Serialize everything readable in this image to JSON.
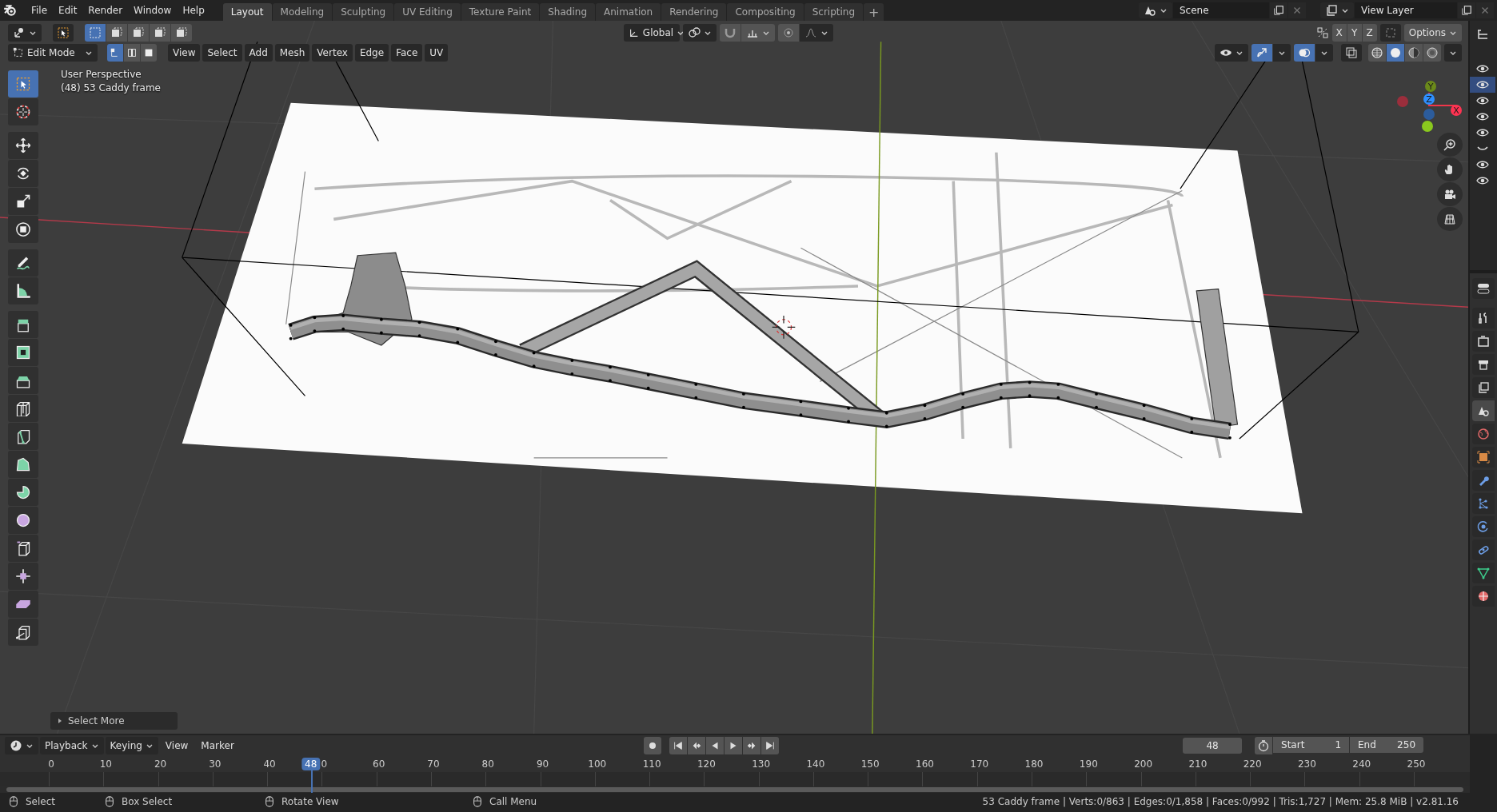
{
  "top_bar": {
    "menus": [
      "File",
      "Edit",
      "Render",
      "Window",
      "Help"
    ],
    "workspaces": [
      {
        "label": "Layout",
        "selected": true
      },
      {
        "label": "Modeling",
        "selected": false
      },
      {
        "label": "Sculpting",
        "selected": false
      },
      {
        "label": "UV Editing",
        "selected": false
      },
      {
        "label": "Texture Paint",
        "selected": false
      },
      {
        "label": "Shading",
        "selected": false
      },
      {
        "label": "Animation",
        "selected": false
      },
      {
        "label": "Rendering",
        "selected": false
      },
      {
        "label": "Compositing",
        "selected": false
      },
      {
        "label": "Scripting",
        "selected": false
      }
    ],
    "add_workspace": "+",
    "scene": "Scene",
    "view_layer": "View Layer"
  },
  "viewport": {
    "header": {
      "mode": "Edit Mode",
      "select_modes": [
        {
          "selected": true
        },
        {
          "selected": false
        },
        {
          "selected": false
        }
      ],
      "menus": [
        "View",
        "Select",
        "Add",
        "Mesh",
        "Vertex",
        "Edge",
        "Face",
        "UV"
      ],
      "transform_orientation": "Global",
      "mirror_axes": [
        {
          "label": "X",
          "on": false
        },
        {
          "label": "Y",
          "on": false
        },
        {
          "label": "Z",
          "on": false
        }
      ],
      "options": "Options",
      "gizmos_on": true,
      "overlays_on": true,
      "xray_on": false,
      "shading": [
        {
          "kind": "wireframe",
          "selected": false
        },
        {
          "kind": "solid",
          "selected": true
        },
        {
          "kind": "material",
          "selected": false
        },
        {
          "kind": "rendered",
          "selected": false
        }
      ]
    },
    "info": [
      "User Perspective",
      "(48) 53 Caddy frame"
    ],
    "tool_groups": [
      [
        {
          "kind": "select-box",
          "selected": true
        },
        {
          "kind": "cursor",
          "selected": false
        }
      ],
      [
        {
          "kind": "move",
          "selected": false
        },
        {
          "kind": "rotate",
          "selected": false
        },
        {
          "kind": "scale",
          "selected": false
        },
        {
          "kind": "transform",
          "selected": false
        }
      ],
      [
        {
          "kind": "annotate",
          "selected": false
        },
        {
          "kind": "measure",
          "selected": false
        }
      ],
      [
        {
          "kind": "extrude",
          "selected": false
        },
        {
          "kind": "inset",
          "selected": false
        },
        {
          "kind": "bevel",
          "selected": false
        },
        {
          "kind": "loop-cut",
          "selected": false
        },
        {
          "kind": "knife",
          "selected": false
        },
        {
          "kind": "poly-build",
          "selected": false
        },
        {
          "kind": "spin",
          "selected": false
        },
        {
          "kind": "smooth",
          "selected": false
        },
        {
          "kind": "edge-slide",
          "selected": false
        },
        {
          "kind": "shrink",
          "selected": false
        },
        {
          "kind": "shear",
          "selected": false
        },
        {
          "kind": "rip",
          "selected": false
        }
      ]
    ],
    "axes": {
      "x": "X",
      "y": "Y",
      "z": "Z"
    },
    "last_operator": "Select More"
  },
  "outliner": {
    "rows": [
      {
        "visible": true,
        "selected": false
      },
      {
        "visible": true,
        "selected": true
      },
      {
        "visible": true,
        "selected": false
      },
      {
        "visible": true,
        "selected": false
      },
      {
        "visible": true,
        "selected": false
      },
      {
        "visible": false,
        "selected": false
      },
      {
        "visible": true,
        "selected": false
      },
      {
        "visible": true,
        "selected": false
      }
    ]
  },
  "properties_tabs": [
    {
      "kind": "tool",
      "selected": false
    },
    {
      "kind": "render",
      "selected": false
    },
    {
      "kind": "output",
      "selected": false
    },
    {
      "kind": "view-layer",
      "selected": false
    },
    {
      "kind": "scene",
      "selected": true
    },
    {
      "kind": "world",
      "selected": false
    },
    {
      "kind": "object",
      "selected": false
    },
    {
      "kind": "modifiers",
      "selected": false
    },
    {
      "kind": "particles",
      "selected": false
    },
    {
      "kind": "physics",
      "selected": false
    },
    {
      "kind": "constraints",
      "selected": false
    },
    {
      "kind": "data",
      "selected": false
    },
    {
      "kind": "material",
      "selected": false
    }
  ],
  "timeline": {
    "menus": [
      "Playback",
      "Keying",
      "View",
      "Marker"
    ],
    "current_frame": "48",
    "start_label": "Start",
    "start": "1",
    "end_label": "End",
    "end": "250",
    "ruler": [
      "0",
      "10",
      "20",
      "30",
      "40",
      "0",
      "60",
      "70",
      "80",
      "90",
      "100",
      "110",
      "120",
      "130",
      "140",
      "150",
      "160",
      "170",
      "180",
      "190",
      "200",
      "210",
      "220",
      "230",
      "240",
      "250"
    ],
    "playhead": {
      "label": "48",
      "level": 0.192
    }
  },
  "status_bar": {
    "hints": [
      "Select",
      "Box Select",
      "Rotate View",
      "Call Menu"
    ],
    "stats": "53 Caddy frame | Verts:0/863 | Edges:0/1,858 | Faces:0/992 | Tris:1,727 | Mem: 25.8 MiB | v2.81.16"
  }
}
